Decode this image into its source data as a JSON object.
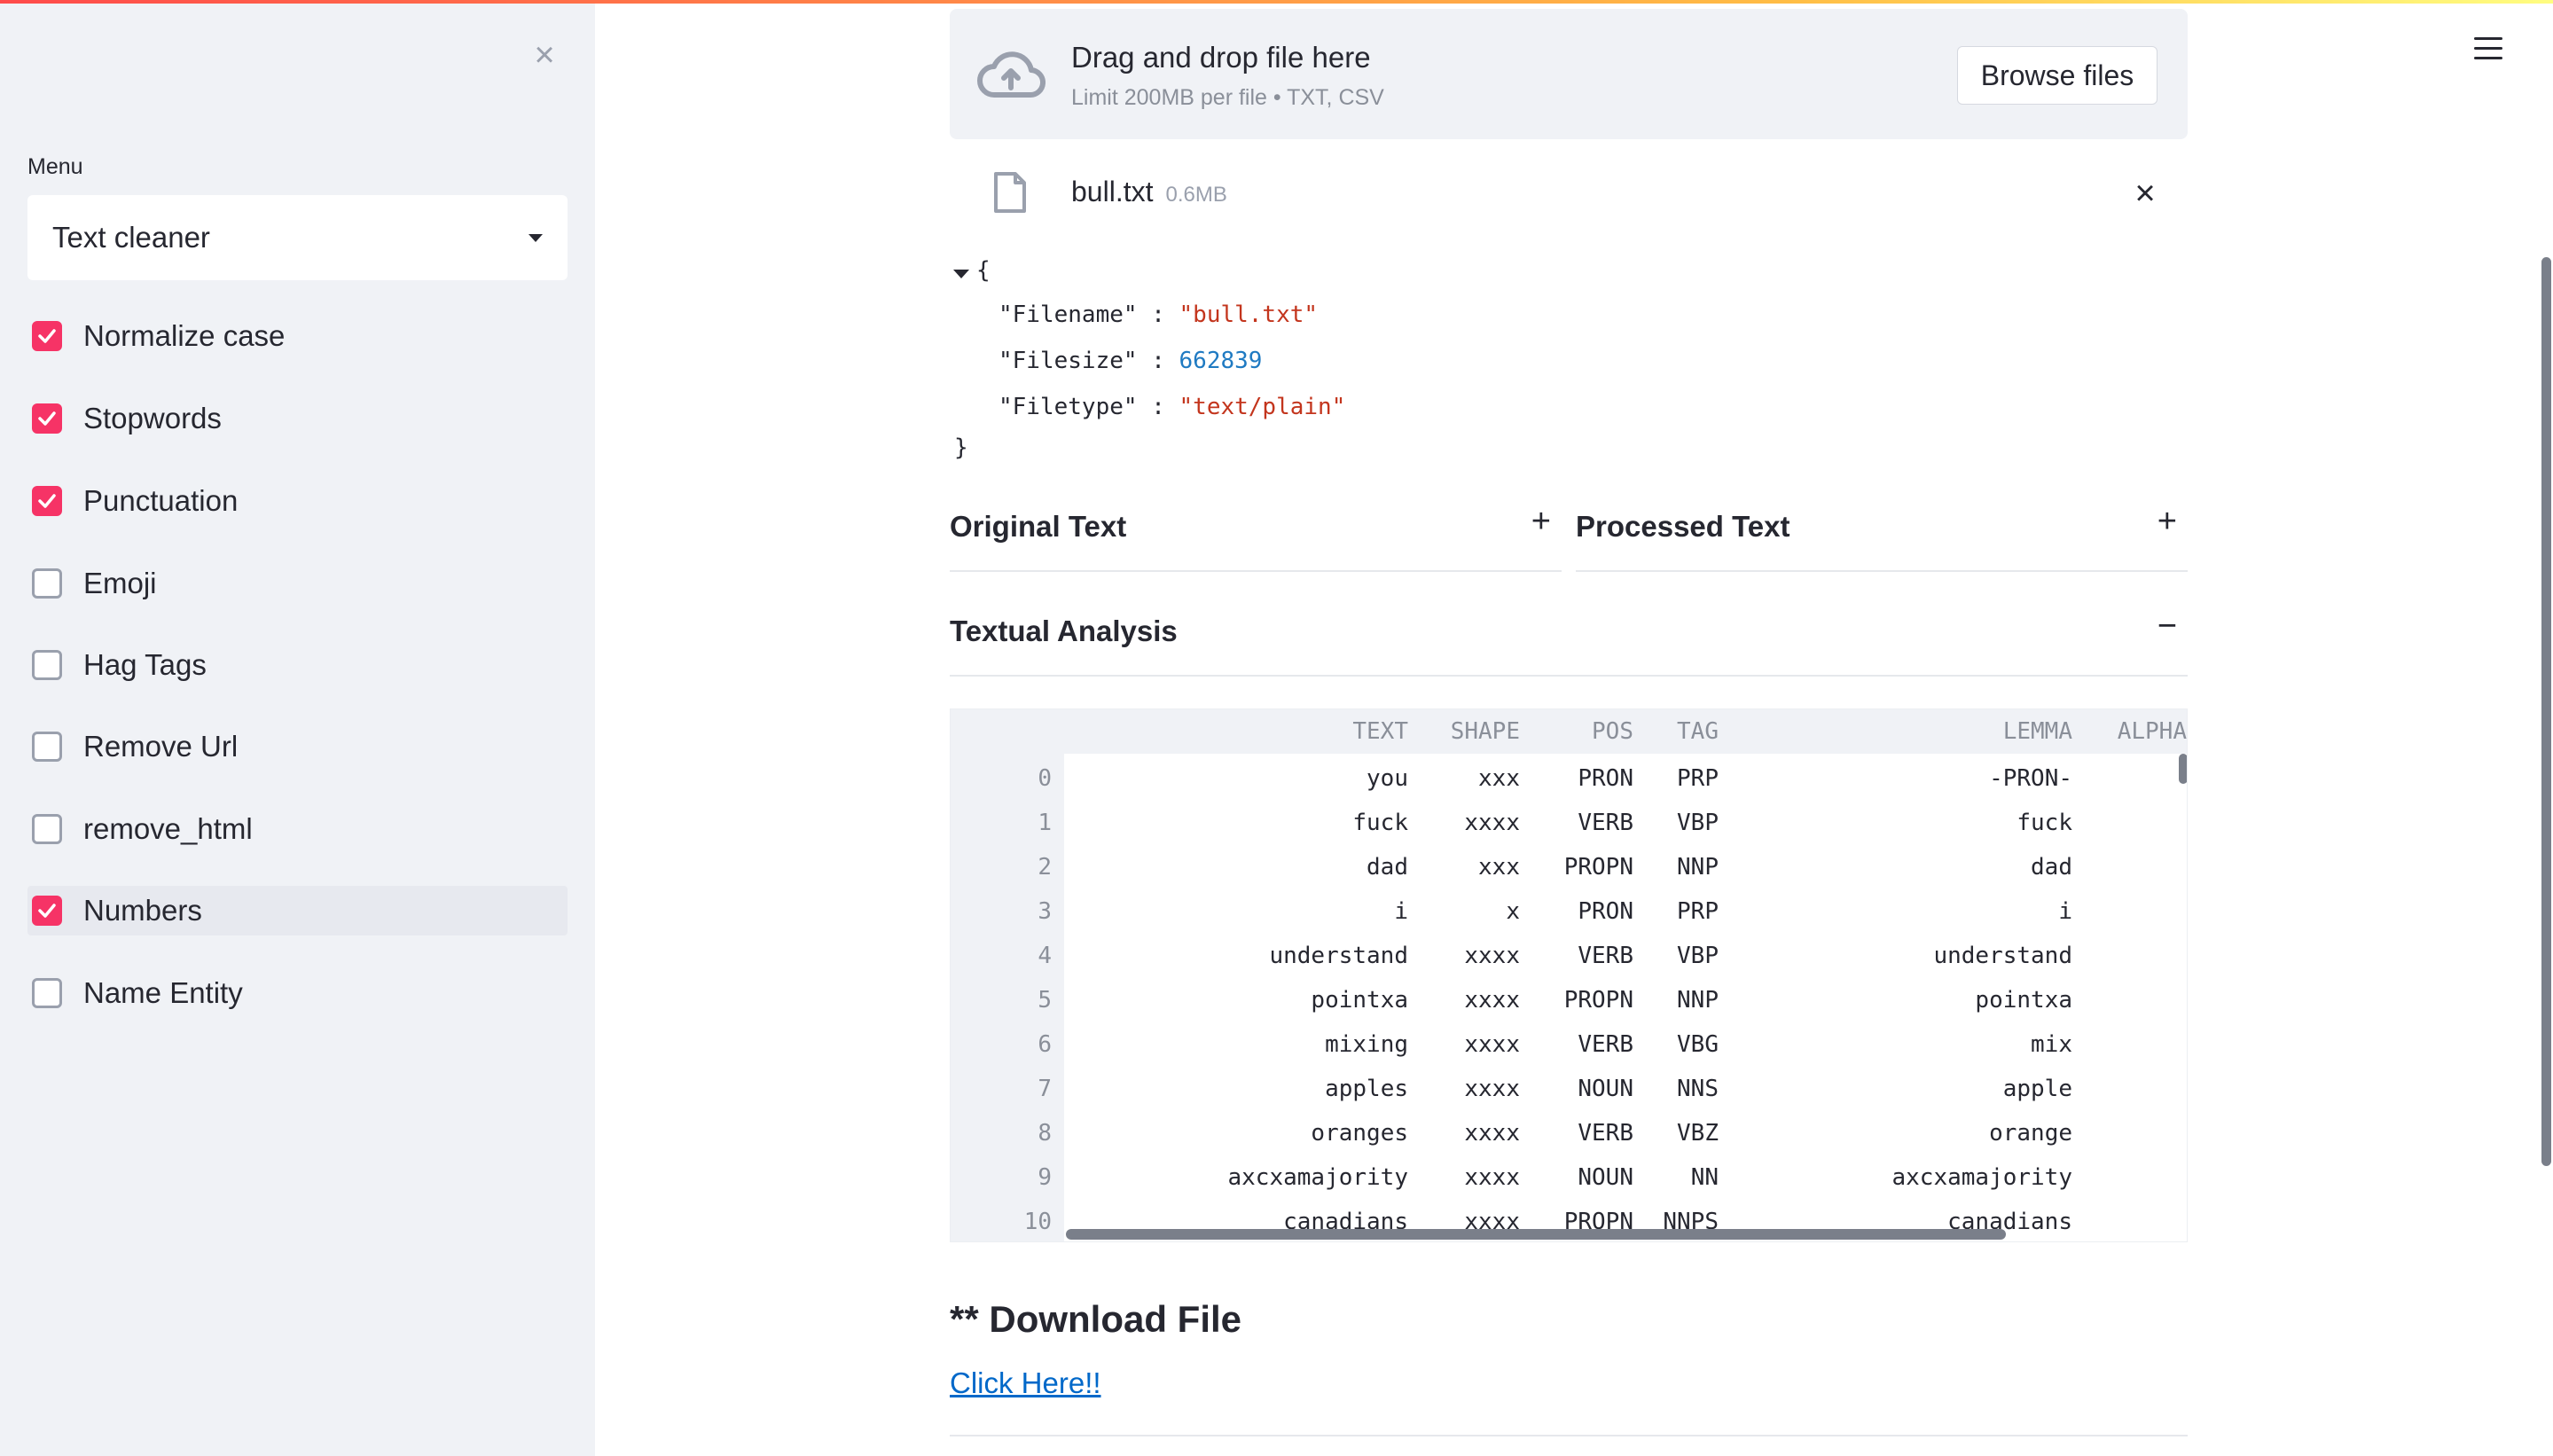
{
  "sidebar": {
    "close_icon": "close-x",
    "menu_label": "Menu",
    "select_value": "Text cleaner",
    "options": [
      {
        "label": "Normalize case",
        "checked": true
      },
      {
        "label": "Stopwords",
        "checked": true
      },
      {
        "label": "Punctuation",
        "checked": true
      },
      {
        "label": "Emoji",
        "checked": false
      },
      {
        "label": "Hag Tags",
        "checked": false
      },
      {
        "label": "Remove Url",
        "checked": false
      },
      {
        "label": "remove_html",
        "checked": false
      },
      {
        "label": "Numbers",
        "checked": true
      },
      {
        "label": "Name Entity",
        "checked": false
      }
    ]
  },
  "uploader": {
    "title": "Drag and drop file here",
    "subtitle": "Limit 200MB per file • TXT, CSV",
    "browse_label": "Browse files",
    "file_name": "bull.txt",
    "file_size": "0.6MB"
  },
  "json_view": {
    "open": "{",
    "close": "}",
    "entries": [
      {
        "key": "\"Filename\"",
        "sep": " : ",
        "value": "\"bull.txt\"",
        "kind": "str"
      },
      {
        "key": "\"Filesize\"",
        "sep": " : ",
        "value": "662839",
        "kind": "num"
      },
      {
        "key": "\"Filetype\"",
        "sep": " : ",
        "value": "\"text/plain\"",
        "kind": "str"
      }
    ]
  },
  "expanders": {
    "original": {
      "title": "Original Text",
      "sign": "+"
    },
    "processed": {
      "title": "Processed Text",
      "sign": "+"
    },
    "analysis": {
      "title": "Textual Analysis",
      "sign": "−"
    }
  },
  "table": {
    "columns": [
      "TEXT",
      "SHAPE",
      "POS",
      "TAG",
      "LEMMA",
      "ALPHA"
    ],
    "rows": [
      {
        "idx": "0",
        "TEXT": "you",
        "SHAPE": "xxx",
        "POS": "PRON",
        "TAG": "PRP",
        "LEMMA": "-PRON-"
      },
      {
        "idx": "1",
        "TEXT": "fuck",
        "SHAPE": "xxxx",
        "POS": "VERB",
        "TAG": "VBP",
        "LEMMA": "fuck"
      },
      {
        "idx": "2",
        "TEXT": "dad",
        "SHAPE": "xxx",
        "POS": "PROPN",
        "TAG": "NNP",
        "LEMMA": "dad"
      },
      {
        "idx": "3",
        "TEXT": "i",
        "SHAPE": "x",
        "POS": "PRON",
        "TAG": "PRP",
        "LEMMA": "i"
      },
      {
        "idx": "4",
        "TEXT": "understand",
        "SHAPE": "xxxx",
        "POS": "VERB",
        "TAG": "VBP",
        "LEMMA": "understand"
      },
      {
        "idx": "5",
        "TEXT": "pointxa",
        "SHAPE": "xxxx",
        "POS": "PROPN",
        "TAG": "NNP",
        "LEMMA": "pointxa"
      },
      {
        "idx": "6",
        "TEXT": "mixing",
        "SHAPE": "xxxx",
        "POS": "VERB",
        "TAG": "VBG",
        "LEMMA": "mix"
      },
      {
        "idx": "7",
        "TEXT": "apples",
        "SHAPE": "xxxx",
        "POS": "NOUN",
        "TAG": "NNS",
        "LEMMA": "apple"
      },
      {
        "idx": "8",
        "TEXT": "oranges",
        "SHAPE": "xxxx",
        "POS": "VERB",
        "TAG": "VBZ",
        "LEMMA": "orange"
      },
      {
        "idx": "9",
        "TEXT": "axcxamajority",
        "SHAPE": "xxxx",
        "POS": "NOUN",
        "TAG": "NN",
        "LEMMA": "axcxamajority"
      },
      {
        "idx": "10",
        "TEXT": "canadians",
        "SHAPE": "xxxx",
        "POS": "PROPN",
        "TAG": "NNPS",
        "LEMMA": "canadians"
      }
    ]
  },
  "download": {
    "title": "** Download File",
    "link_label": "Click Here!!"
  },
  "colors": {
    "accent": "#f63366",
    "link": "#0068c9",
    "json_string": "#c3351d",
    "json_number": "#1f7ac2"
  }
}
